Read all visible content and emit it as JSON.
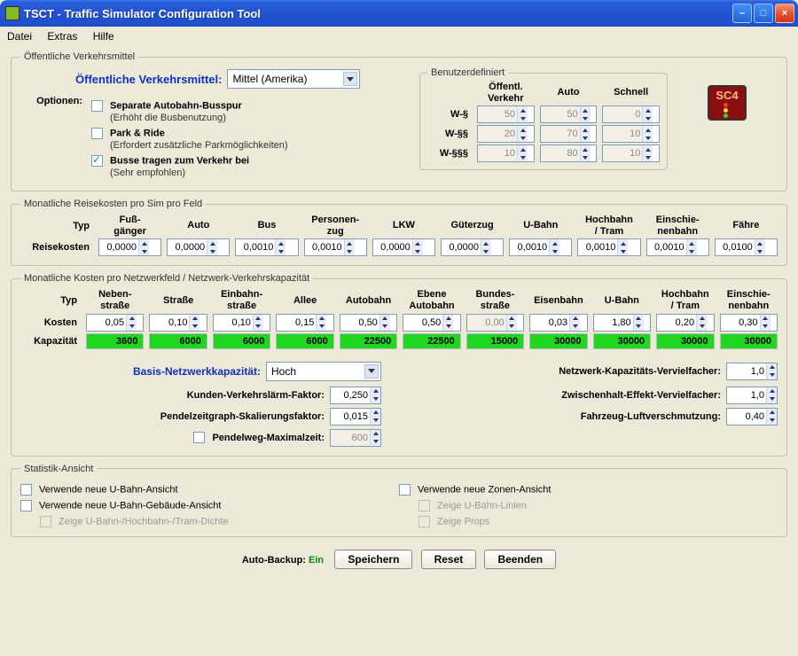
{
  "window": {
    "title": "TSCT - Traffic Simulator Configuration Tool"
  },
  "menu": {
    "file": "Datei",
    "extras": "Extras",
    "help": "Hilfe"
  },
  "pubtrans": {
    "legend": "Öffentliche Verkehrsmittel",
    "label": "Öffentliche Verkehrsmittel:",
    "select_value": "Mittel (Amerika)",
    "options_label": "Optionen:",
    "opt1": "Separate Autobahn-Busspur",
    "opt1_sub": "(Erhöht die Busbenutzung)",
    "opt2": "Park & Ride",
    "opt2_sub": "(Erfordert zusätzliche Parkmöglichkeiten)",
    "opt3": "Busse tragen zum Verkehr bei",
    "opt3_sub": "(Sehr empfohlen)",
    "custom": {
      "legend": "Benutzerdefiniert",
      "h1": "Öffentl. Verkehr",
      "h2": "Auto",
      "h3": "Schnell",
      "r1": "W-§",
      "v1a": "50",
      "v1b": "50",
      "v1c": "0",
      "r2": "W-§§",
      "v2a": "20",
      "v2b": "70",
      "v2c": "10",
      "r3": "W-§§§",
      "v3a": "10",
      "v3b": "80",
      "v3c": "10"
    }
  },
  "travel": {
    "legend": "Monatliche Reisekosten pro Sim pro Feld",
    "typ": "Typ",
    "row": "Reisekosten",
    "cols": [
      "Fuß-\ngänger",
      "Auto",
      "Bus",
      "Personen-\nzug",
      "LKW",
      "Güterzug",
      "U-Bahn",
      "Hochbahn\n/ Tram",
      "Einschie-\nnenbahn",
      "Fähre"
    ],
    "vals": [
      "0,0000",
      "0,0000",
      "0,0010",
      "0,0010",
      "0,0000",
      "0,0000",
      "0,0010",
      "0,0010",
      "0,0010",
      "0,0100"
    ]
  },
  "net": {
    "legend": "Monatliche Kosten pro Netzwerkfeld / Netzwerk-Verkehrskapazität",
    "typ": "Typ",
    "row1": "Kosten",
    "row2": "Kapazität",
    "cols": [
      "Neben-\nstraße",
      "Straße",
      "Einbahn-\nstraße",
      "Allee",
      "Autobahn",
      "Ebene\nAutobahn",
      "Bundes-\nstraße",
      "Eisenbahn",
      "U-Bahn",
      "Hochbahn\n/ Tram",
      "Einschie-\nnenbahn"
    ],
    "cost": [
      "0,05",
      "0,10",
      "0,10",
      "0,15",
      "0,50",
      "0,50",
      "0,00",
      "0,03",
      "1,80",
      "0,20",
      "0,30"
    ],
    "cap": [
      "3600",
      "6000",
      "6000",
      "6000",
      "22500",
      "22500",
      "15000",
      "30000",
      "30000",
      "30000",
      "30000"
    ],
    "basis_label": "Basis-Netzwerkkapazität:",
    "basis_value": "Hoch",
    "noise_label": "Kunden-Verkehrslärm-Faktor:",
    "noise_value": "0,250",
    "scale_label": "Pendelzeitgraph-Skalierungsfaktor:",
    "scale_value": "0,015",
    "maxtime_label": "Pendelweg-Maximalzeit:",
    "maxtime_value": "600",
    "mult_label": "Netzwerk-Kapazitäts-Vervielfacher:",
    "mult_value": "1,0",
    "stop_label": "Zwischenhalt-Effekt-Vervielfacher:",
    "stop_value": "1,0",
    "pollute_label": "Fahrzeug-Luftverschmutzung:",
    "pollute_value": "0,40"
  },
  "stats": {
    "legend": "Statistik-Ansicht",
    "s1": "Verwende neue U-Bahn-Ansicht",
    "s2": "Verwende neue U-Bahn-Gebäude-Ansicht",
    "s3": "Zeige U-Bahn-/Hochbahn-/Tram-Dichte",
    "s4": "Verwende neue Zonen-Ansicht",
    "s5": "Zeige U-Bahn-Linien",
    "s6": "Zeige Props"
  },
  "foot": {
    "autolabel": "Auto-Backup:",
    "autoval": "Ein",
    "save": "Speichern",
    "reset": "Reset",
    "quit": "Beenden"
  },
  "logo": "SC4"
}
